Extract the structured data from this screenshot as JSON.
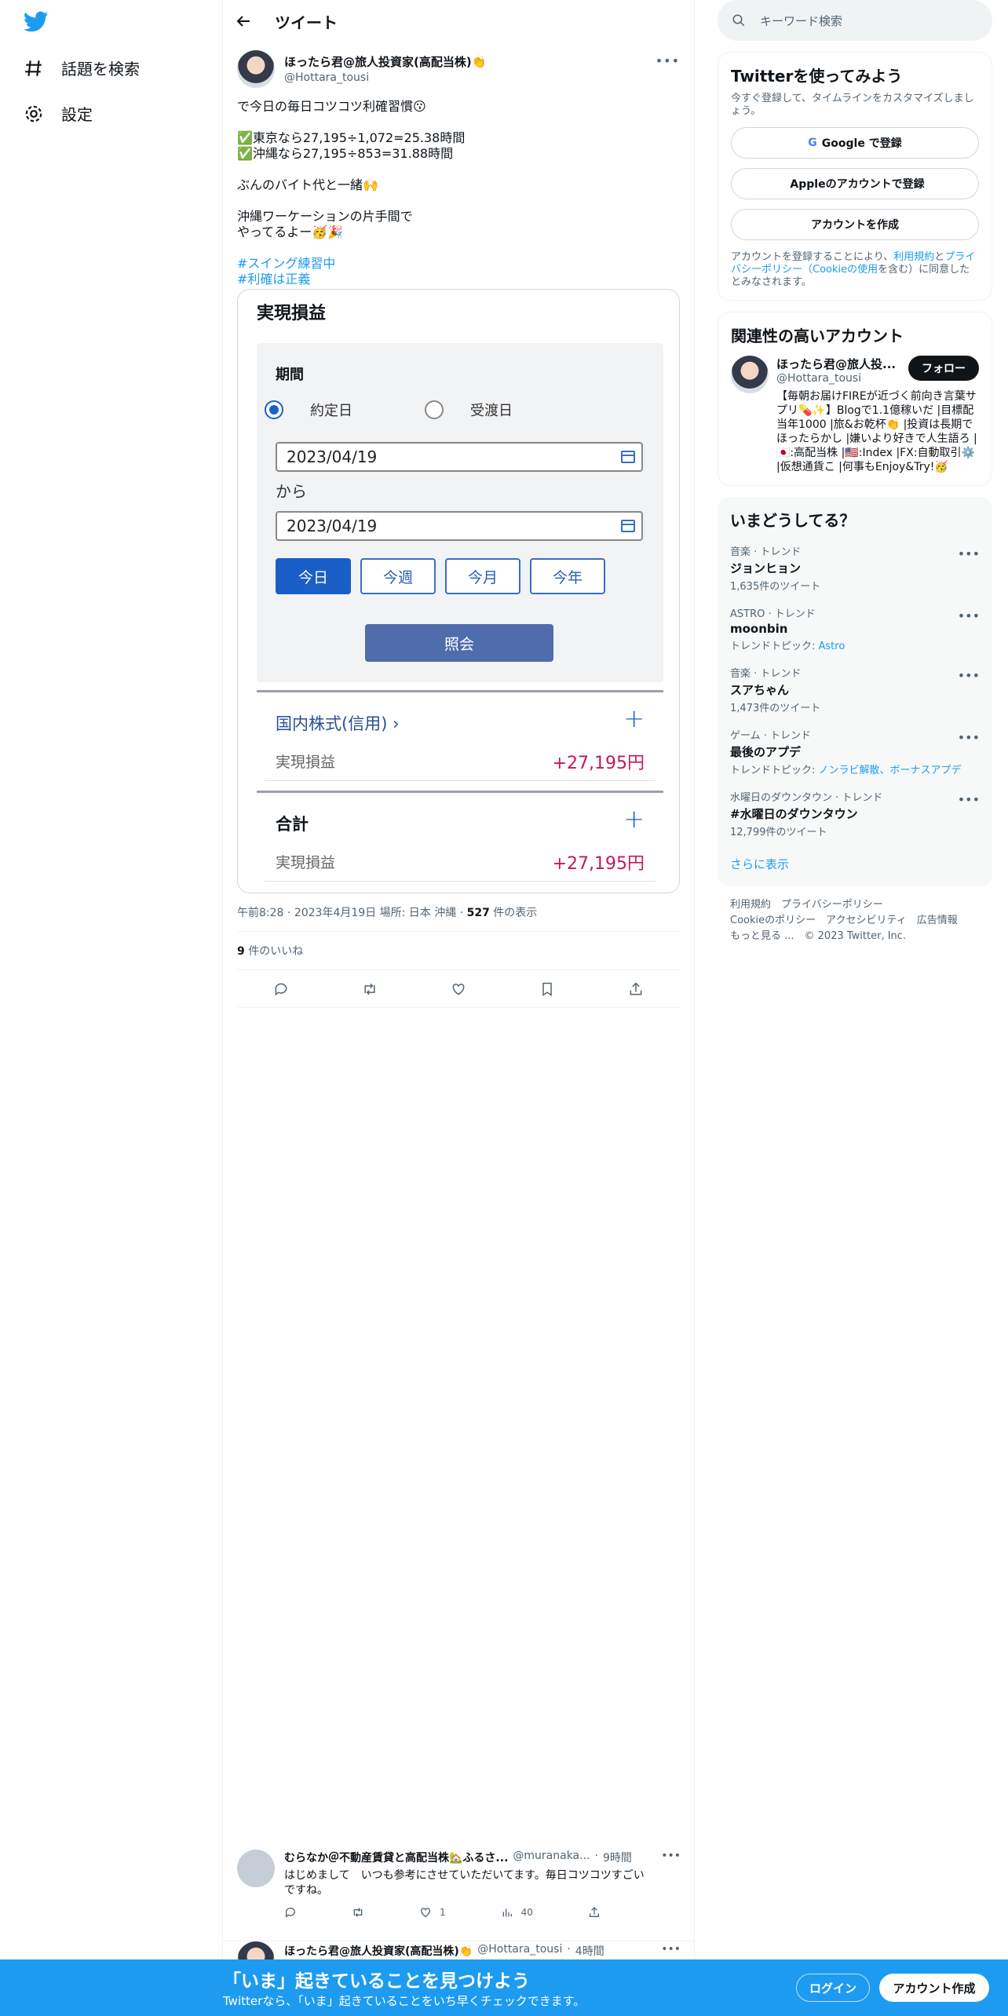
{
  "nav": {
    "explore": "話題を検索",
    "settings": "設定"
  },
  "header": {
    "title": "ツイート"
  },
  "tweet": {
    "name": "ほったら君@旅人投資家(高配当株)",
    "name_emoji": "👏",
    "handle": "@Hottara_tousi",
    "line1": "で今日の毎日コツコツ利確習慣😗",
    "line2": "✅東京なら27,195÷1,072=25.38時間",
    "line3": "✅沖縄なら27,195÷853=31.88時間",
    "line4": "ぶんのバイト代と一緒🙌",
    "line5": "沖縄ワーケーションの片手間で",
    "line6": "やってるよー🥳🎉",
    "tag1": "#スイング練習中",
    "tag2": "#利確は正義",
    "meta_time": "午前8:28",
    "meta_date": "2023年4月19日",
    "meta_place": "場所: 日本 沖縄",
    "views": "527",
    "views_label": "件の表示",
    "likes": "9",
    "likes_label": "件のいいね"
  },
  "card": {
    "title": "実現損益",
    "period_label": "期間",
    "radio1": "約定日",
    "radio2": "受渡日",
    "date_from": "2023/04/19",
    "kara": "から",
    "date_to": "2023/04/19",
    "btn_today": "今日",
    "btn_week": "今週",
    "btn_month": "今月",
    "btn_year": "今年",
    "query": "照会",
    "sec1_title": "国内株式(信用)",
    "sec1_label": "実現損益",
    "sec1_value": "+27,195円",
    "sec2_title": "合計",
    "sec2_label": "実現損益",
    "sec2_value": "+27,195円"
  },
  "replies": [
    {
      "name": "むらなか＠不動産賃貸と高配当株🏡ふるさ...",
      "handle": "@muranaka...",
      "time": "9時間",
      "text1": "はじめまして　いつも参考にさせていただいてます。毎日コツコツすごい",
      "text2": "ですね。",
      "likes": "1",
      "views": "40"
    },
    {
      "name": "ほったら君@旅人投資家(高配当株)👏",
      "handle": "@Hottara_tousi",
      "time": "4時間"
    }
  ],
  "right": {
    "search_placeholder": "キーワード検索",
    "signup_title": "Twitterを使ってみよう",
    "signup_sub": "今すぐ登録して、タイムラインをカスタマイズしましょう。",
    "google": "Google で登録",
    "apple": "Appleのアカウントで登録",
    "create": "アカウントを作成",
    "terms_a": "アカウントを登録することにより、",
    "terms_link1": "利用規約",
    "terms_b": "と",
    "terms_link2": "プライバシーポリシー（Cookieの使用",
    "terms_c": "を含む）に同意したとみなされます。",
    "related_title": "関連性の高いアカウント",
    "rel_name": "ほったら君@旅人投...",
    "rel_handle": "@Hottara_tousi",
    "follow": "フォロー",
    "rel_bio": "【毎朝お届けFIREが近づく前向き言葉サプリ💊✨】Blogで1.1億稼いだ |目標配当年1000 |旅&お乾杯👏 |投資は長期でほったらかし |嫌いより好きで人生語ろ |🇯🇵:高配当株 |🇺🇸:Index |FX:自動取引⚙️ |仮想通貨こ |何事もEnjoy&Try!🥳",
    "trends_title": "いまどうしてる？",
    "trends": [
      {
        "cat": "音楽 · トレンド",
        "name": "ジョンヒョン",
        "extra": "1,635件のツイート"
      },
      {
        "cat": "ASTRO · トレンド",
        "name": "moonbin",
        "extra_prefix": "トレンドトピック: ",
        "extra_link": "Astro"
      },
      {
        "cat": "音楽 · トレンド",
        "name": "スアちゃん",
        "extra": "1,473件のツイート"
      },
      {
        "cat": "ゲーム · トレンド",
        "name": "最後のアプデ",
        "extra_prefix": "トレンドトピック: ",
        "extra_link": "ノンラビ解散、ボーナスアプデ"
      },
      {
        "cat": "水曜日のダウンタウン · トレンド",
        "name": "#水曜日のダウンタウン",
        "extra": "12,799件のツイート"
      }
    ],
    "show_more": "さらに表示",
    "footer1": "利用規約　プライバシーポリシー",
    "footer2": "Cookieのポリシー　アクセシビリティ　広告情報",
    "footer3": "もっと見る ...　© 2023 Twitter, Inc."
  },
  "banner": {
    "title": "「いま」起きていることを見つけよう",
    "sub": "Twitterなら、「いま」起きていることをいち早くチェックできます。",
    "login": "ログイン",
    "signup": "アカウント作成"
  },
  "colors": {
    "brand": "#1d9bf0",
    "gain": "#c2185b",
    "accent": "#1a5fc8"
  }
}
